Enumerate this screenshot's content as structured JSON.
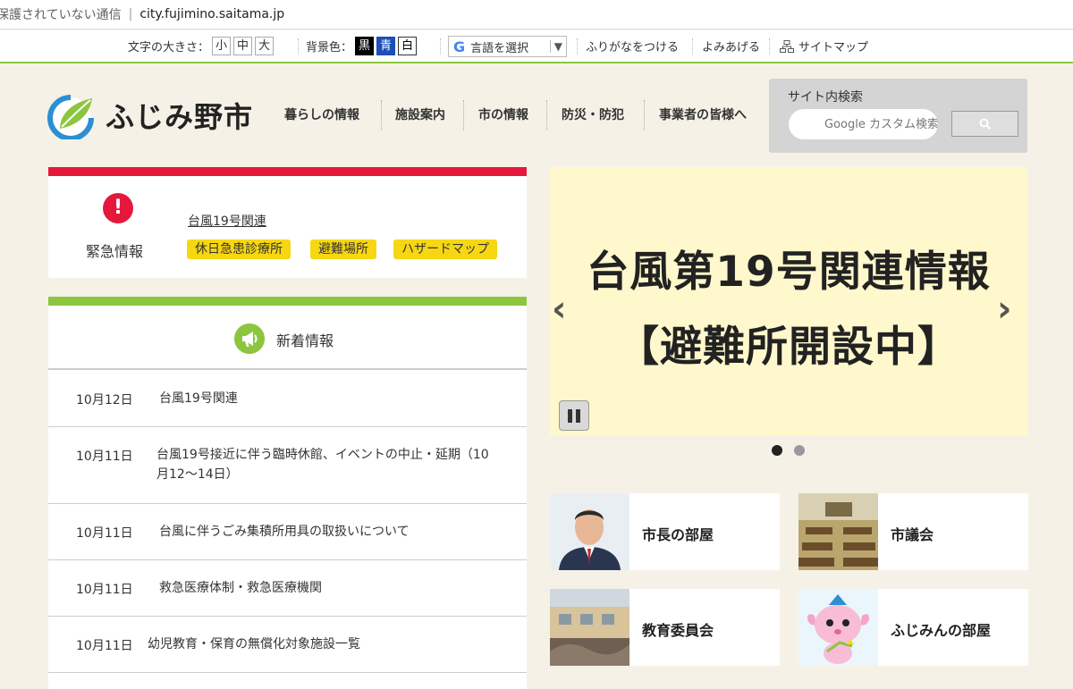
{
  "browser": {
    "security_text": "保護されていない通信",
    "url": "city.fujimino.saitama.jp"
  },
  "utility": {
    "font_size_label": "文字の大きさ：",
    "font_sizes": [
      "小",
      "中",
      "大"
    ],
    "bg_color_label": "背景色：",
    "bg_colors": [
      "黒",
      "青",
      "白"
    ],
    "translate_label": "言語を選択",
    "furigana_label": "ふりがなをつける",
    "read_aloud_label": "よみあげる",
    "sitemap_label": "サイトマップ"
  },
  "header": {
    "logo_text": "ふじみ野市",
    "nav": [
      "暮らしの情報",
      "施設案内",
      "市の情報",
      "防災・防犯",
      "事業者の皆様へ"
    ],
    "search": {
      "label": "サイト内検索",
      "placeholder": "Google カスタム検索"
    }
  },
  "emergency": {
    "title": "緊急情報",
    "link": "台風19号関連",
    "tags": [
      "休日急患診療所",
      "避難場所",
      "ハザードマップ"
    ],
    "accent": "#e5183c"
  },
  "news": {
    "title": "新着情報",
    "accent": "#8cc63f",
    "items": [
      {
        "date": "10月12日",
        "text": "台風19号関連"
      },
      {
        "date": "10月11日",
        "text": "台風19号接近に伴う臨時休館、イベントの中止・延期（10月12～14日）"
      },
      {
        "date": "10月11日",
        "text": "台風に伴うごみ集積所用具の取扱いについて"
      },
      {
        "date": "10月11日",
        "text": "救急医療体制・救急医療機関"
      },
      {
        "date": "10月11日",
        "text": "幼児教育・保育の無償化対象施設一覧"
      }
    ]
  },
  "slider": {
    "line1": "台風第19号関連情報",
    "line2": "【避難所開設中】",
    "prev": "‹",
    "next": "›"
  },
  "cards": [
    {
      "label": "市長の部屋"
    },
    {
      "label": "市議会"
    },
    {
      "label": "教育委員会"
    },
    {
      "label": "ふじみんの部屋"
    }
  ]
}
